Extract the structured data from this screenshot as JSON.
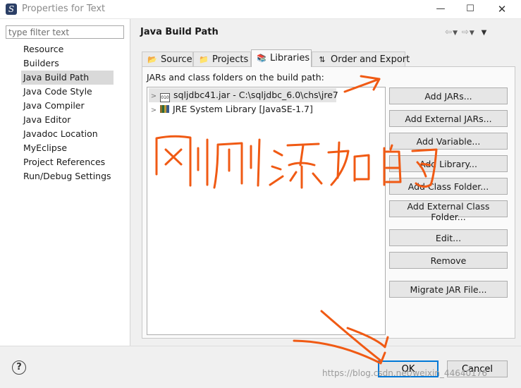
{
  "window": {
    "title": "Properties for Text",
    "minimize": "—",
    "maximize": "☐",
    "close": "✕"
  },
  "sidebar": {
    "filter_placeholder": "type filter text",
    "items": [
      "Resource",
      "Builders",
      "Java Build Path",
      "Java Code Style",
      "Java Compiler",
      "Java Editor",
      "Javadoc Location",
      "MyEclipse",
      "Project References",
      "Run/Debug Settings"
    ],
    "selected": "Java Build Path"
  },
  "header": {
    "title": "Java Build Path"
  },
  "tabs": [
    {
      "label": "Source",
      "icon": "source-folder-icon"
    },
    {
      "label": "Projects",
      "icon": "projects-icon"
    },
    {
      "label": "Libraries",
      "icon": "libraries-icon",
      "active": true
    },
    {
      "label": "Order and Export",
      "icon": "order-export-icon"
    }
  ],
  "libraries": {
    "label": "JARs and class folders on the build path:",
    "entries": [
      {
        "text": "sqljdbc41.jar - C:\\sqljdbc_6.0\\chs\\jre7",
        "icon": "jar-icon",
        "selected": true
      },
      {
        "text": "JRE System Library [JavaSE-1.7]",
        "icon": "library-icon"
      }
    ],
    "buttons": [
      "Add JARs...",
      "Add External JARs...",
      "Add Variable...",
      "Add Library...",
      "Add Class Folder...",
      "Add External Class Folder...",
      "Edit...",
      "Remove",
      "Migrate JAR File..."
    ]
  },
  "footer": {
    "help": "?",
    "ok": "OK",
    "cancel": "Cancel",
    "watermark": "https://blog.csdn.net/weixin_44640176"
  },
  "annotation": {
    "color": "#f05a14"
  }
}
